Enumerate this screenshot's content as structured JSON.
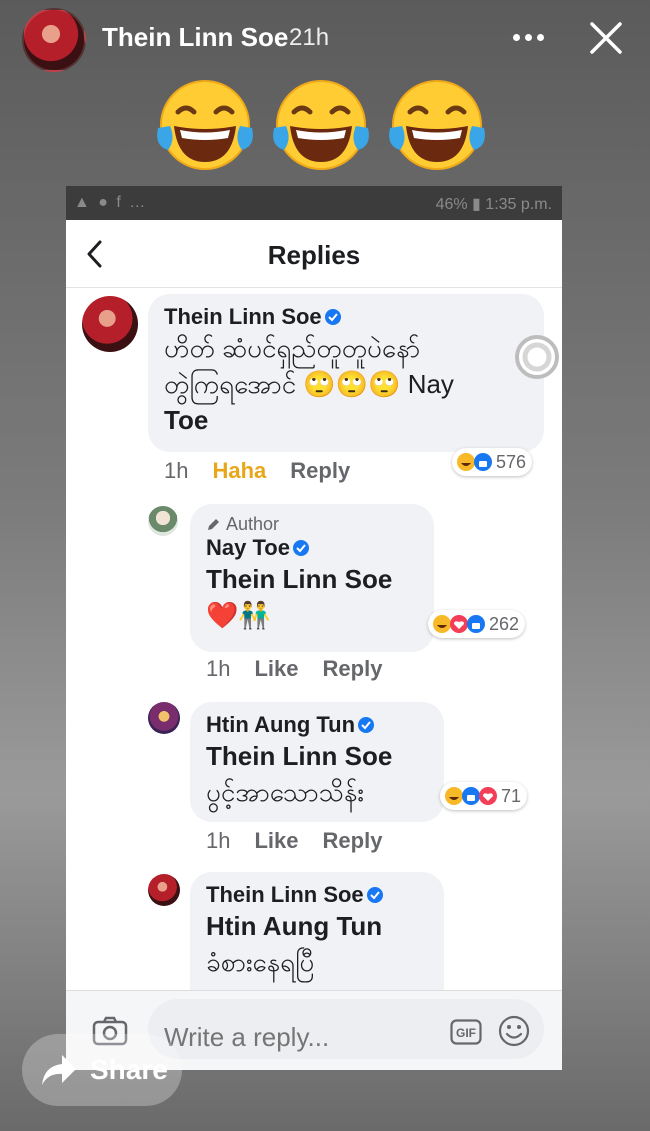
{
  "story": {
    "user_name": "Thein Linn Soe",
    "time_ago": "21h"
  },
  "emoji_row": [
    "laughing-with-tears",
    "laughing-with-tears",
    "laughing-with-tears"
  ],
  "phone_status": {
    "left_icons": "▲ ● f …",
    "right_text": "46% ▮ 1:35 p.m."
  },
  "screen": {
    "title": "Replies"
  },
  "comments": [
    {
      "name": "Thein Linn Soe",
      "lines": [
        "ဟိတ် ဆံပင်ရှည်တူတူပဲနော်",
        "တွဲကြရအောင် 🙄🙄🙄 Nay",
        "Toe"
      ],
      "actions": {
        "time": "1h",
        "react": "Haha",
        "reply": "Reply"
      },
      "reaction_count": "576"
    },
    {
      "author_tag": "Author",
      "name": "Nay Toe",
      "lines": [
        "Thein Linn Soe",
        "❤️👬"
      ],
      "actions": {
        "time": "1h",
        "react": "Like",
        "reply": "Reply"
      },
      "reaction_count": "262"
    },
    {
      "name": "Htin Aung Tun",
      "lines": [
        "Thein Linn Soe",
        "ပွင့်အာသောသိန်း"
      ],
      "actions": {
        "time": "1h",
        "react": "Like",
        "reply": "Reply"
      },
      "reaction_count": "71"
    },
    {
      "name": "Thein Linn Soe",
      "lines": [
        "Htin Aung Tun",
        "ခံစားနေရပြီ"
      ]
    }
  ],
  "reply_bar": {
    "placeholder": "Write a reply...",
    "gif_label": "GIF"
  },
  "share": {
    "label": "Share"
  },
  "colors": {
    "haha": "#e8a71a",
    "like_blue": "#1877f2",
    "love_red": "#f33e58",
    "verified_blue": "#1877f2"
  }
}
